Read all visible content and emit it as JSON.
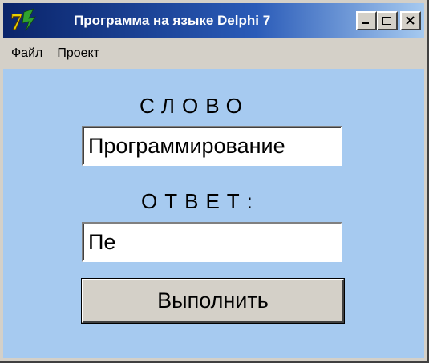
{
  "window": {
    "title": "Программа на языке Delphi 7",
    "icon": "delphi-7-icon",
    "controls": {
      "minimize_icon": "minimize-icon",
      "maximize_icon": "maximize-icon",
      "close_icon": "close-icon"
    }
  },
  "menu": {
    "items": [
      {
        "label": "Файл"
      },
      {
        "label": "Проект"
      }
    ]
  },
  "form": {
    "word_label": "СЛОВО",
    "word_value": "Программирование",
    "answer_label": "ОТВЕТ:",
    "answer_value": "Пе",
    "run_button_label": "Выполнить"
  },
  "colors": {
    "client_background": "#a6caf0",
    "titlebar_start": "#0a246a",
    "titlebar_end": "#a6caf0",
    "face": "#d4d0c8"
  }
}
